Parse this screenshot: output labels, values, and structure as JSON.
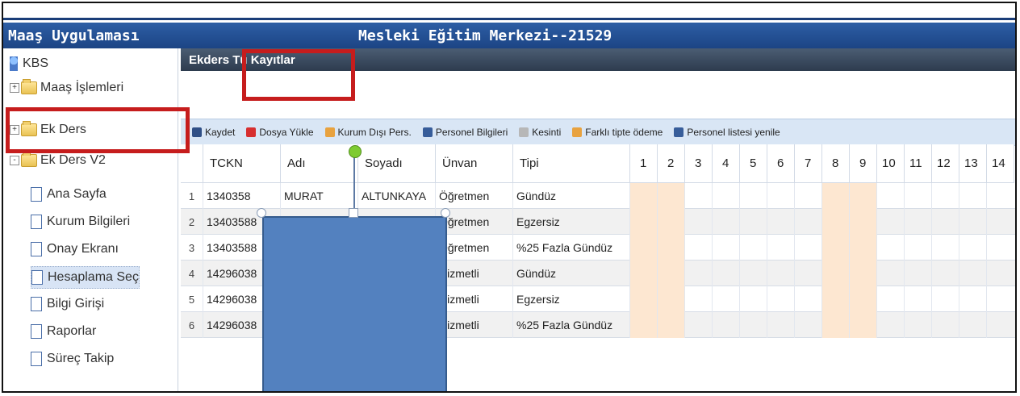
{
  "header": {
    "app_title": "Maaş Uygulaması",
    "center_title": "Mesleki Eğitim Merkezi--21529"
  },
  "sidebar": {
    "items": [
      {
        "label": "KBS",
        "kind": "root"
      },
      {
        "label": "Maaş İşlemleri",
        "kind": "folder",
        "expander": "+"
      },
      {
        "label": "Ek Ders",
        "kind": "folder",
        "expander": "+"
      },
      {
        "label": "Ek Ders V2",
        "kind": "folder",
        "expander": "-"
      },
      {
        "label": "Ana Sayfa",
        "kind": "page"
      },
      {
        "label": "Kurum Bilgileri",
        "kind": "page"
      },
      {
        "label": "Onay Ekranı",
        "kind": "page"
      },
      {
        "label": "Hesaplama Seç",
        "kind": "page",
        "selected": true
      },
      {
        "label": "Bilgi Girişi",
        "kind": "page"
      },
      {
        "label": "Raporlar",
        "kind": "page"
      },
      {
        "label": "Süreç Takip",
        "kind": "page"
      }
    ]
  },
  "panel": {
    "title": "Ekders Tü   Kayıtlar"
  },
  "toolbar": {
    "buttons": [
      {
        "label": "Kaydet",
        "icon": "save-icon"
      },
      {
        "label": "Dosya Yükle",
        "icon": "upload-icon"
      },
      {
        "label": "Kurum Dışı Pers.",
        "icon": "users-icon"
      },
      {
        "label": "Personel Bilgileri",
        "icon": "card-icon"
      },
      {
        "label": "Kesinti",
        "icon": "cut-icon"
      },
      {
        "label": "Farklı tipte ödeme",
        "icon": "users-icon"
      },
      {
        "label": "Personel listesi yenile",
        "icon": "card-icon"
      }
    ]
  },
  "grid": {
    "headers": [
      "TCKN",
      "Adı",
      "Soyadı",
      "Ünvan",
      "Tipi",
      "1",
      "2",
      "3",
      "4",
      "5",
      "6",
      "7",
      "8",
      "9",
      "10",
      "11",
      "12",
      "13",
      "14"
    ],
    "rows": [
      {
        "n": "1",
        "tckn": "1340358",
        "adi": "MURAT",
        "soyadi": "ALTUNKAYA",
        "unvan": "Öğretmen",
        "tipi": "Gündüz"
      },
      {
        "n": "2",
        "tckn": "13403588",
        "adi": "",
        "soyadi": "",
        "unvan": "Öğretmen",
        "tipi": "Egzersiz"
      },
      {
        "n": "3",
        "tckn": "13403588",
        "adi": "",
        "soyadi": "",
        "unvan": "Öğretmen",
        "tipi": "%25 Fazla Gündüz"
      },
      {
        "n": "4",
        "tckn": "14296038",
        "adi": "",
        "soyadi": "",
        "unvan": "Hizmetli",
        "tipi": "Gündüz"
      },
      {
        "n": "5",
        "tckn": "14296038",
        "adi": "",
        "soyadi": "",
        "unvan": "Hizmetli",
        "tipi": "Egzersiz"
      },
      {
        "n": "6",
        "tckn": "14296038",
        "adi": "",
        "soyadi": "",
        "unvan": "Hizmetli",
        "tipi": "%25 Fazla Gündüz"
      }
    ],
    "highlight_days": [
      "1",
      "2",
      "8",
      "9"
    ],
    "highlight_color": "#fde7d1"
  },
  "colors": {
    "title_bar": "#1f4b8f",
    "annotation_red": "#c61d1d",
    "overlay_blue": "#5381bf"
  }
}
